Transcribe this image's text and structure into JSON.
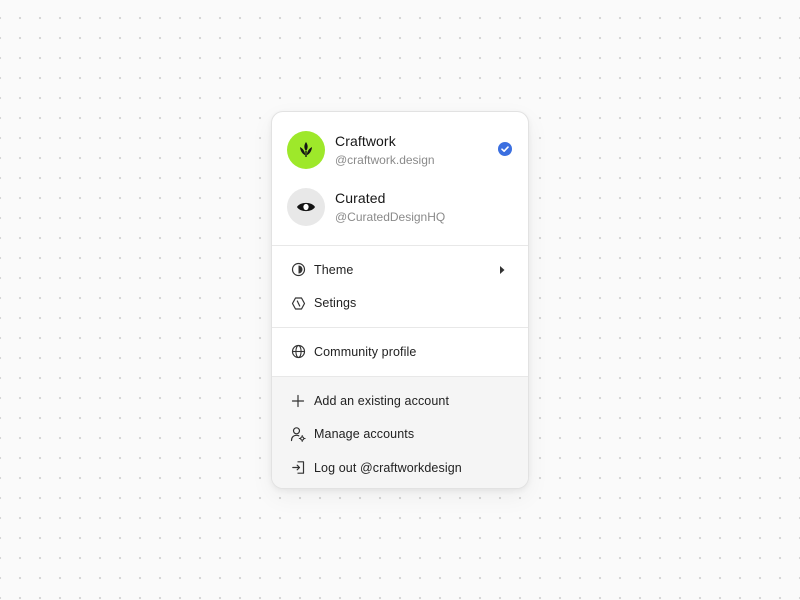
{
  "accounts": [
    {
      "name": "Craftwork",
      "handle": "@craftwork.design",
      "avatar_icon": "sprout-icon",
      "avatar_color": "#9ee82a",
      "selected": true
    },
    {
      "name": "Curated",
      "handle": "@CuratedDesignHQ",
      "avatar_icon": "eye-icon",
      "avatar_color": "#e8e8e8",
      "selected": false
    }
  ],
  "menu": {
    "theme": {
      "label": "Theme",
      "icon": "contrast-icon",
      "has_submenu": true
    },
    "settings": {
      "label": "Setings",
      "icon": "hexagon-slash-icon"
    },
    "community": {
      "label": "Community profile",
      "icon": "globe-icon"
    },
    "add_account": {
      "label": "Add an existing account",
      "icon": "plus-icon"
    },
    "manage_accounts": {
      "label": "Manage accounts",
      "icon": "user-gear-icon"
    },
    "logout": {
      "label": "Log out @craftworkdesign",
      "icon": "logout-icon"
    }
  },
  "colors": {
    "accent_check": "#3b6fe0",
    "footer_bg": "#f5f5f5"
  }
}
